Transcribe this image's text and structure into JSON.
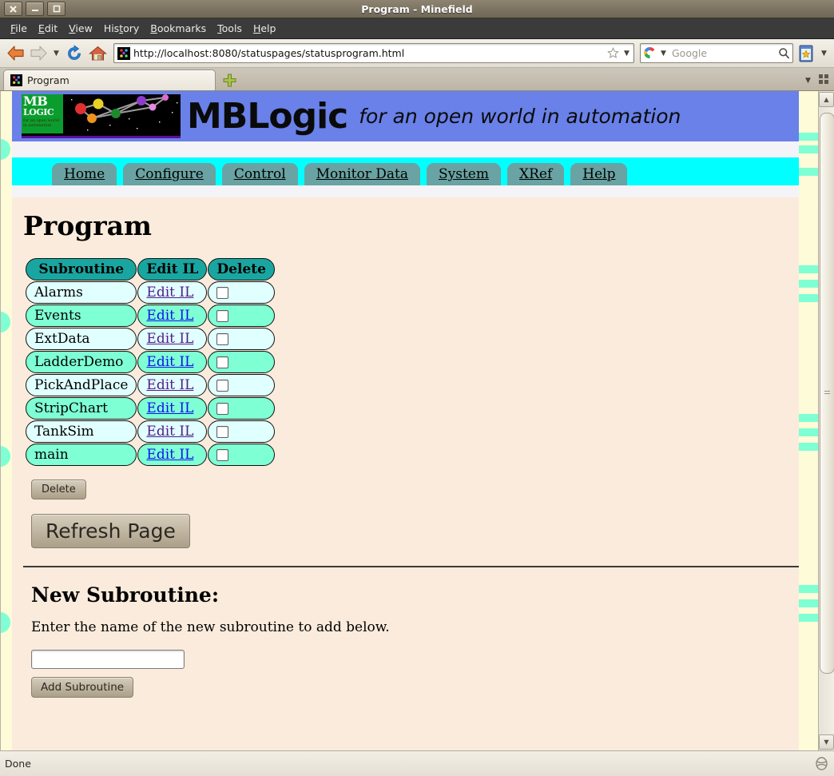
{
  "window": {
    "title": "Program - Minefield",
    "buttons": [
      {
        "name": "close",
        "glyph": "✕"
      },
      {
        "name": "minimize",
        "glyph": "—"
      },
      {
        "name": "maximize",
        "glyph": "□"
      }
    ]
  },
  "menubar": {
    "items": [
      "File",
      "Edit",
      "View",
      "History",
      "Bookmarks",
      "Tools",
      "Help"
    ]
  },
  "toolbar": {
    "back_icon": "back-arrow-icon",
    "forward_icon": "forward-arrow-icon",
    "history_dropdown_icon": "chevron-down-icon",
    "reload_icon": "reload-icon",
    "home_icon": "home-icon",
    "url": "http://localhost:8080/statuspages/statusprogram.html",
    "url_star_icon": "bookmark-star-icon",
    "url_dropdown_icon": "chevron-down-icon",
    "search_placeholder": "Google",
    "search_engine_icon": "google-icon",
    "search_submit_icon": "magnifier-icon",
    "bookmarks_icon": "bookmarks-toolbar-icon",
    "bookmarks_dropdown_icon": "chevron-down-icon"
  },
  "tabstrip": {
    "tabs": [
      {
        "label": "Program",
        "favicon": "mblogic-favicon"
      }
    ],
    "new_tab_icon": "plus-icon",
    "list_all_tabs_icon": "chevron-down-icon",
    "app_menu_icon": "grid-icon"
  },
  "banner": {
    "logo_line1": "MB",
    "logo_line2": "LOGIC",
    "logo_line3": "for an open world in automation",
    "title": "MBLogic",
    "tagline": "for an open world in automation",
    "bg_color": "#6981e8"
  },
  "nav": {
    "bg_color": "#00ffff",
    "tab_color": "#6aa3a3",
    "items": [
      "Home",
      "Configure",
      "Control",
      "Monitor Data",
      "System",
      "XRef",
      "Help"
    ]
  },
  "main": {
    "page_title": "Program",
    "table": {
      "headers": [
        "Subroutine",
        "Edit IL",
        "Delete"
      ],
      "edit_link_label": "Edit IL",
      "rows": [
        {
          "subroutine": "Alarms",
          "edit": "Edit IL",
          "delete_checked": false
        },
        {
          "subroutine": "Events",
          "edit": "Edit IL",
          "delete_checked": false
        },
        {
          "subroutine": "ExtData",
          "edit": "Edit IL",
          "delete_checked": false
        },
        {
          "subroutine": "LadderDemo",
          "edit": "Edit IL",
          "delete_checked": false
        },
        {
          "subroutine": "PickAndPlace",
          "edit": "Edit IL",
          "delete_checked": false
        },
        {
          "subroutine": "StripChart",
          "edit": "Edit IL",
          "delete_checked": false
        },
        {
          "subroutine": "TankSim",
          "edit": "Edit IL",
          "delete_checked": false
        },
        {
          "subroutine": "main",
          "edit": "Edit IL",
          "delete_checked": false
        }
      ],
      "header_color": "#1aa6a0",
      "row_odd_color": "#e0ffff",
      "row_even_color": "#7fffd4"
    },
    "delete_button": "Delete",
    "refresh_button": "Refresh Page",
    "new_subroutine": {
      "heading": "New Subroutine:",
      "instruction": "Enter the name of the new subroutine to add below.",
      "input_value": "",
      "input_placeholder": "",
      "add_button": "Add Subroutine"
    }
  },
  "scrollbar": {
    "up_arrow": "▲",
    "down_arrow": "▼"
  },
  "statusbar": {
    "text": "Done",
    "grip_icon": "resize-grip-icon"
  }
}
